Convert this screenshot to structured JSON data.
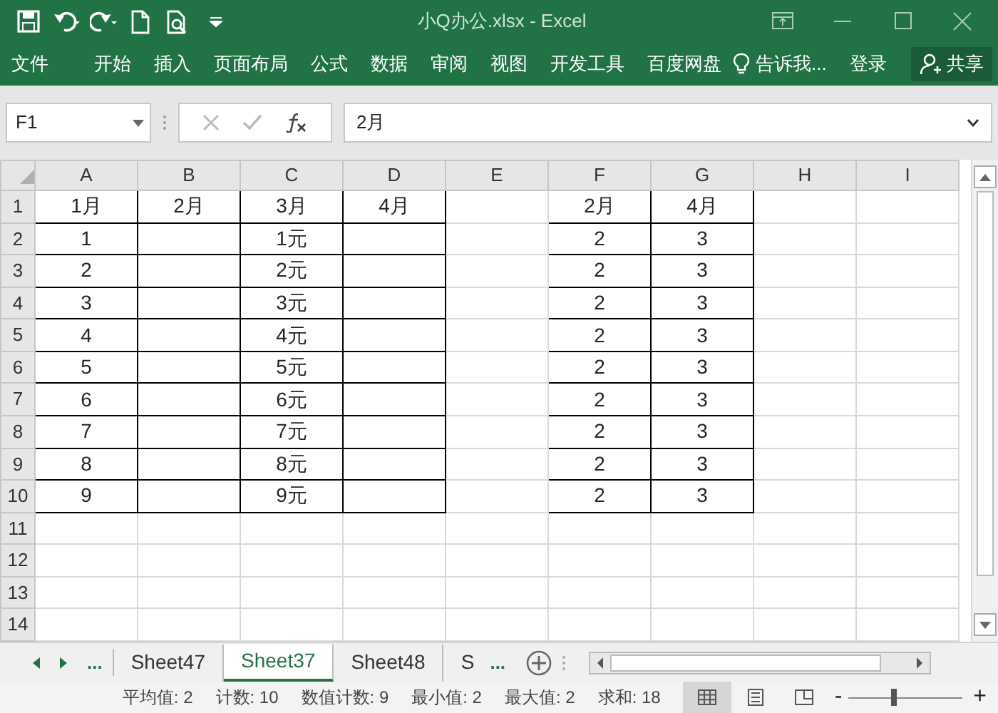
{
  "window": {
    "title": "小Q办公.xlsx - Excel"
  },
  "ribbon": {
    "tabs": [
      {
        "label": "文件"
      },
      {
        "label": "开始"
      },
      {
        "label": "插入"
      },
      {
        "label": "页面布局"
      },
      {
        "label": "公式"
      },
      {
        "label": "数据"
      },
      {
        "label": "审阅"
      },
      {
        "label": "视图"
      },
      {
        "label": "开发工具"
      },
      {
        "label": "百度网盘"
      }
    ],
    "tell_me": "告诉我...",
    "sign_in": "登录",
    "share": "共享"
  },
  "formula_bar": {
    "name_box": "F1",
    "formula": "2月"
  },
  "sheet": {
    "columns": [
      "A",
      "B",
      "C",
      "D",
      "E",
      "F",
      "G",
      "H",
      "I"
    ],
    "rows": [
      {
        "number": "1",
        "cells": [
          {
            "text": "1月",
            "bordered": true
          },
          {
            "text": "2月",
            "bordered": true
          },
          {
            "text": "3月",
            "bordered": true
          },
          {
            "text": "4月",
            "bordered": true
          },
          null,
          {
            "text": "2月",
            "bordered": true
          },
          {
            "text": "4月",
            "bordered": true
          },
          null,
          null
        ]
      },
      {
        "number": "2",
        "cells": [
          {
            "text": "1",
            "bordered": true
          },
          {
            "bordered": true
          },
          {
            "text": "1元",
            "bordered": true
          },
          {
            "bordered": true
          },
          null,
          {
            "text": "2",
            "bordered": true
          },
          {
            "text": "3",
            "bordered": true
          },
          null,
          null
        ]
      },
      {
        "number": "3",
        "cells": [
          {
            "text": "2",
            "bordered": true
          },
          {
            "bordered": true
          },
          {
            "text": "2元",
            "bordered": true
          },
          {
            "bordered": true
          },
          null,
          {
            "text": "2",
            "bordered": true
          },
          {
            "text": "3",
            "bordered": true
          },
          null,
          null
        ]
      },
      {
        "number": "4",
        "cells": [
          {
            "text": "3",
            "bordered": true
          },
          {
            "bordered": true
          },
          {
            "text": "3元",
            "bordered": true
          },
          {
            "bordered": true
          },
          null,
          {
            "text": "2",
            "bordered": true
          },
          {
            "text": "3",
            "bordered": true
          },
          null,
          null
        ]
      },
      {
        "number": "5",
        "cells": [
          {
            "text": "4",
            "bordered": true
          },
          {
            "bordered": true
          },
          {
            "text": "4元",
            "bordered": true
          },
          {
            "bordered": true
          },
          null,
          {
            "text": "2",
            "bordered": true
          },
          {
            "text": "3",
            "bordered": true
          },
          null,
          null
        ]
      },
      {
        "number": "6",
        "cells": [
          {
            "text": "5",
            "bordered": true
          },
          {
            "bordered": true
          },
          {
            "text": "5元",
            "bordered": true
          },
          {
            "bordered": true
          },
          null,
          {
            "text": "2",
            "bordered": true
          },
          {
            "text": "3",
            "bordered": true
          },
          null,
          null
        ]
      },
      {
        "number": "7",
        "cells": [
          {
            "text": "6",
            "bordered": true
          },
          {
            "bordered": true
          },
          {
            "text": "6元",
            "bordered": true
          },
          {
            "bordered": true
          },
          null,
          {
            "text": "2",
            "bordered": true
          },
          {
            "text": "3",
            "bordered": true
          },
          null,
          null
        ]
      },
      {
        "number": "8",
        "cells": [
          {
            "text": "7",
            "bordered": true
          },
          {
            "bordered": true
          },
          {
            "text": "7元",
            "bordered": true
          },
          {
            "bordered": true
          },
          null,
          {
            "text": "2",
            "bordered": true
          },
          {
            "text": "3",
            "bordered": true
          },
          null,
          null
        ]
      },
      {
        "number": "9",
        "cells": [
          {
            "text": "8",
            "bordered": true
          },
          {
            "bordered": true
          },
          {
            "text": "8元",
            "bordered": true
          },
          {
            "bordered": true
          },
          null,
          {
            "text": "2",
            "bordered": true
          },
          {
            "text": "3",
            "bordered": true
          },
          null,
          null
        ]
      },
      {
        "number": "10",
        "cells": [
          {
            "text": "9",
            "bordered": true
          },
          {
            "bordered": true
          },
          {
            "text": "9元",
            "bordered": true
          },
          {
            "bordered": true
          },
          null,
          {
            "text": "2",
            "bordered": true
          },
          {
            "text": "3",
            "bordered": true
          },
          null,
          null
        ]
      },
      {
        "number": "11"
      },
      {
        "number": "12"
      },
      {
        "number": "13"
      },
      {
        "number": "14"
      }
    ]
  },
  "sheet_tabs": {
    "more_left": "...",
    "tabs": [
      {
        "label": "Sheet47",
        "selected": false
      },
      {
        "label": "Sheet37",
        "selected": true
      },
      {
        "label": "Sheet48",
        "selected": false
      },
      {
        "label": "S",
        "selected": false
      }
    ],
    "more_right": "..."
  },
  "status_bar": {
    "items": [
      "平均值: 2",
      "计数: 10",
      "数值计数: 9",
      "最小值: 2",
      "最大值: 2",
      "求和: 18"
    ],
    "zoom": {
      "minus": "-",
      "plus": "+",
      "level": 0.4
    }
  }
}
